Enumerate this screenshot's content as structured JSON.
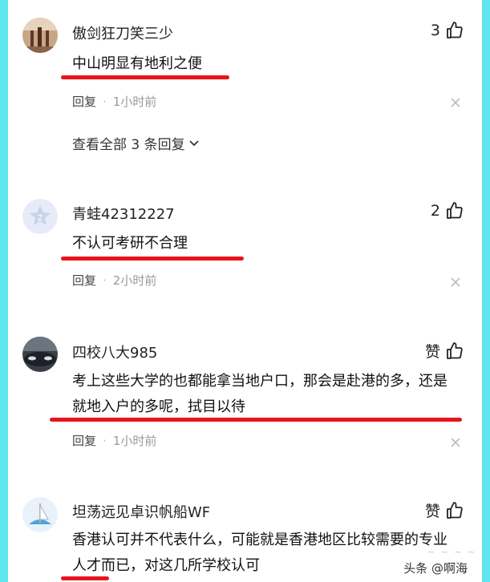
{
  "comments": [
    {
      "username": "傲剑狂刀笑三少",
      "likes": "3",
      "text": "中山明显有地利之便",
      "reply": "回复",
      "time": "1小时前",
      "view_all": "查看全部 3 条回复"
    },
    {
      "username": "青蛙42312227",
      "likes": "2",
      "text": "不认可考研不合理",
      "reply": "回复",
      "time": "2小时前"
    },
    {
      "username": "四校八大985",
      "likes": "赞",
      "text": "考上这些大学的也都能拿当地户口，那会是赴港的多，还是就地入户的多呢，拭目以待",
      "reply": "回复",
      "time": "1小时前"
    },
    {
      "username": "坦荡远见卓识帆船WF",
      "likes": "赞",
      "text": "香港认可并不代表什么，可能就是香港地区比较需要的专业人才而已，对这几所学校认可"
    }
  ],
  "meta_dot": "·",
  "watermark": "头条 @啊海",
  "colors": {
    "background": "#5fe6ee",
    "underline": "#e8141c"
  },
  "icons": [
    "thumbs-up-icon",
    "close-icon",
    "chevron-down-icon"
  ]
}
